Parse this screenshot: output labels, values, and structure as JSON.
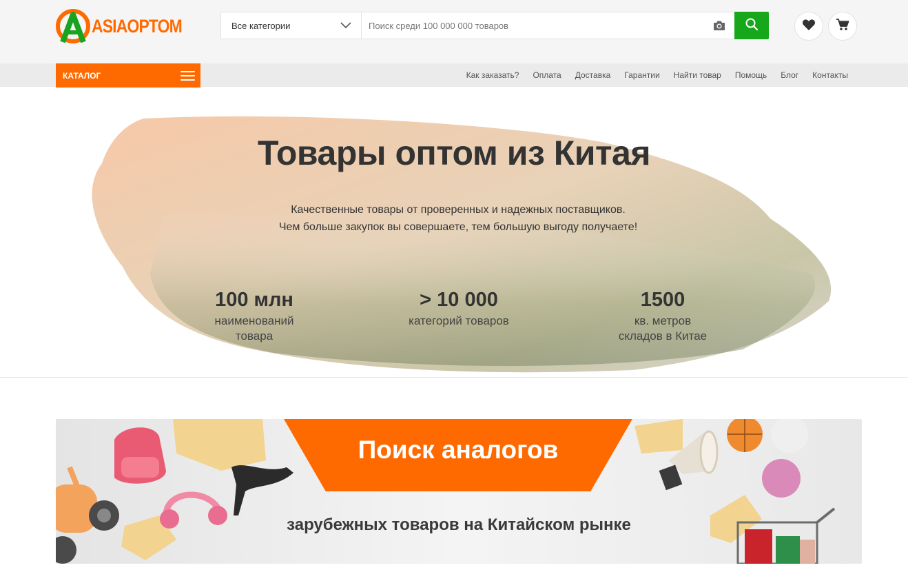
{
  "logo": {
    "part1": "ASIA",
    "part2": "OPTOM"
  },
  "search": {
    "category_selected": "Все категории",
    "placeholder": "Поиск среди 100 000 000 товаров",
    "value": ""
  },
  "header_icons": {
    "favorites": "heart-icon",
    "cart": "cart-icon"
  },
  "navbar": {
    "catalog_label": "КАТАЛОГ",
    "links": [
      "Как заказать?",
      "Оплата",
      "Доставка",
      "Гарантии",
      "Найти товар",
      "Помощь",
      "Блог",
      "Контакты"
    ]
  },
  "hero": {
    "title": "Товары оптом из Китая",
    "subtitle_line1": "Качественные товары от проверенных и надежных поставщиков.",
    "subtitle_line2": "Чем больше закупок вы совершаете, тем большую выгоду получаете!",
    "stats": [
      {
        "value": "100 млн",
        "label_line1": "наименований",
        "label_line2": "товара"
      },
      {
        "value": "> 10 000",
        "label_line1": "категорий товаров",
        "label_line2": ""
      },
      {
        "value": "1500",
        "label_line1": "кв. метров",
        "label_line2": "складов в Китае"
      }
    ]
  },
  "banner": {
    "title": "Поиск аналогов",
    "subtitle": "зарубежных товаров на Китайском рынке"
  },
  "colors": {
    "accent": "#ff6a00",
    "search_button": "#16a81a",
    "logo_green": "#1aa31f"
  }
}
